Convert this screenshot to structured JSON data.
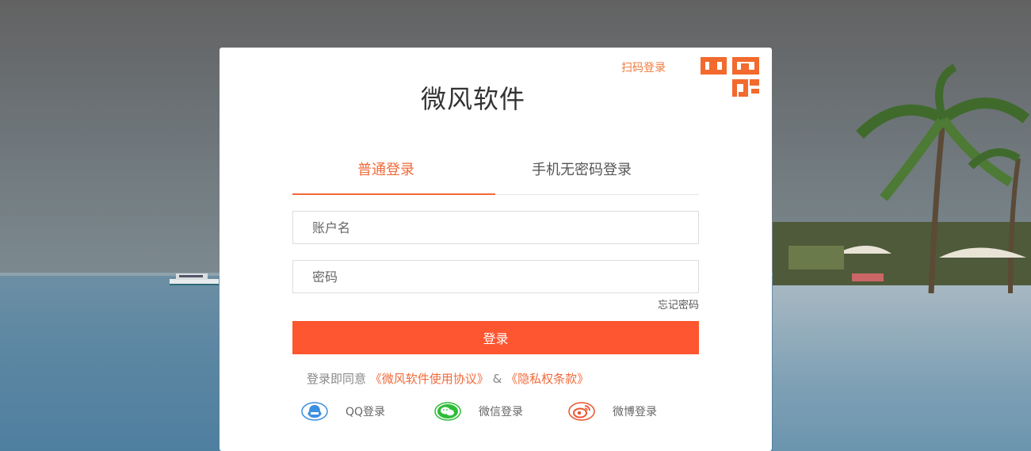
{
  "app": {
    "title": "微风软件"
  },
  "qr_login": {
    "label": "扫码登录"
  },
  "tabs": [
    {
      "label": "普通登录",
      "active": true
    },
    {
      "label": "手机无密码登录",
      "active": false
    }
  ],
  "form": {
    "username_placeholder": "账户名",
    "password_placeholder": "密码",
    "forgot_label": "忘记密码",
    "login_label": "登录"
  },
  "agreement": {
    "prefix": "登录即同意",
    "terms_link": "《微风软件使用协议》",
    "separator": "&",
    "privacy_link": "《隐私权条款》"
  },
  "social": [
    {
      "label": "QQ登录",
      "icon": "qq-icon",
      "color": "#3d8fe0"
    },
    {
      "label": "微信登录",
      "icon": "wechat-icon",
      "color": "#2ebd38"
    },
    {
      "label": "微博登录",
      "icon": "weibo-icon",
      "color": "#e8542d"
    }
  ],
  "colors": {
    "accent": "#f06a3a",
    "button": "#fd5631"
  }
}
